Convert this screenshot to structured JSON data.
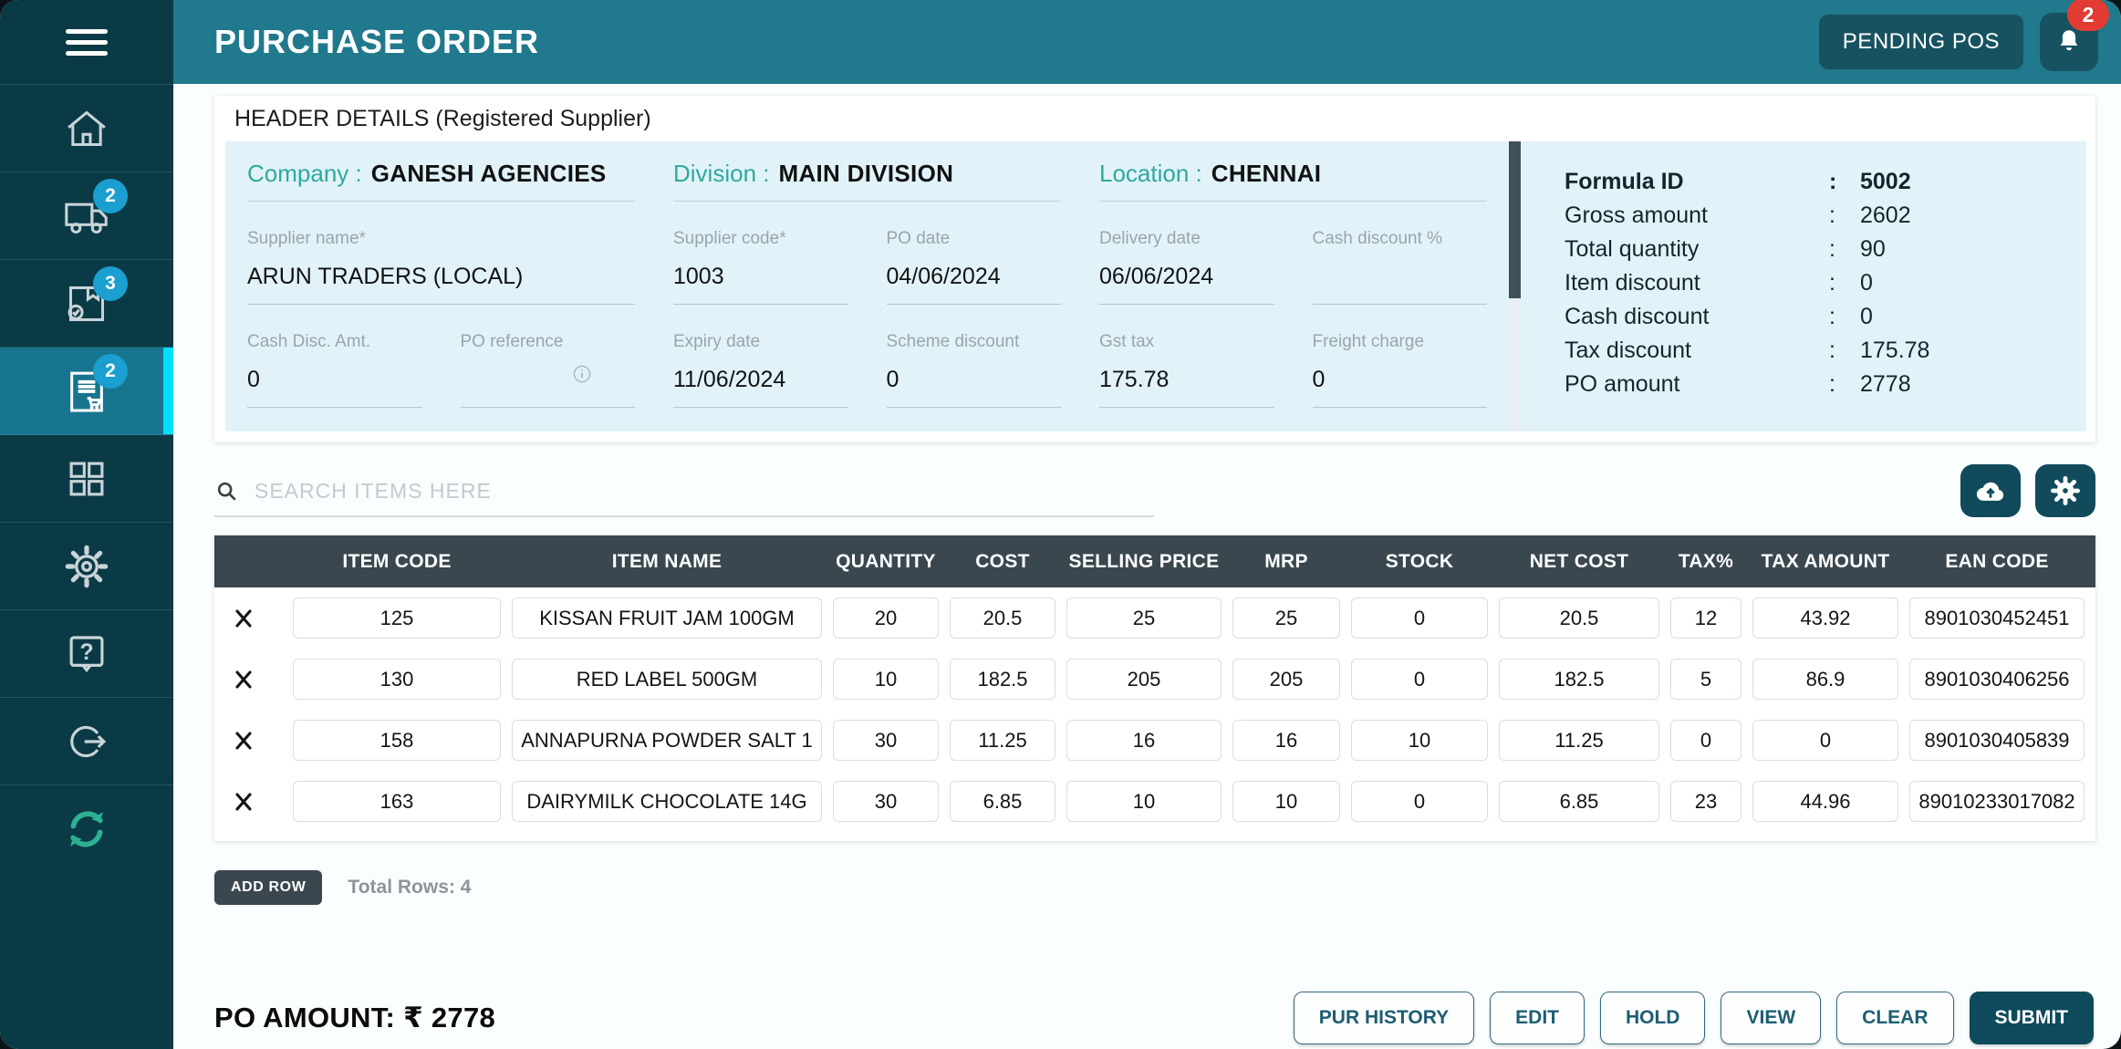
{
  "topbar": {
    "title": "PURCHASE ORDER",
    "pending_pos": "PENDING POS",
    "notification_count": "2"
  },
  "sidebar": {
    "truck_badge": "2",
    "grn_badge": "3",
    "purchase_badge": "2"
  },
  "header": {
    "title": "HEADER DETAILS (Registered Supplier)",
    "company_label": "Company :",
    "company_value": "GANESH AGENCIES",
    "division_label": "Division :",
    "division_value": "MAIN DIVISION",
    "location_label": "Location :",
    "location_value": "CHENNAI",
    "fields": {
      "supplier_name": {
        "label": "Supplier name*",
        "value": "ARUN TRADERS (LOCAL)"
      },
      "supplier_code": {
        "label": "Supplier code*",
        "value": "1003"
      },
      "po_date": {
        "label": "PO date",
        "value": "04/06/2024"
      },
      "delivery_date": {
        "label": "Delivery date",
        "value": "06/06/2024"
      },
      "cash_discount_pct": {
        "label": "Cash discount %",
        "value": ""
      },
      "cash_disc_amt": {
        "label": "Cash Disc. Amt.",
        "value": "0"
      },
      "po_reference": {
        "label": "PO reference",
        "value": ""
      },
      "expiry_date": {
        "label": "Expiry date",
        "value": "11/06/2024"
      },
      "scheme_discount": {
        "label": "Scheme discount",
        "value": "0"
      },
      "gst_tax": {
        "label": "Gst tax",
        "value": "175.78"
      },
      "freight_charge": {
        "label": "Freight charge",
        "value": "0"
      }
    }
  },
  "summary": {
    "rows": [
      {
        "label": "Formula ID",
        "value": "5002"
      },
      {
        "label": "Gross amount",
        "value": "2602"
      },
      {
        "label": "Total quantity",
        "value": "90"
      },
      {
        "label": "Item discount",
        "value": "0"
      },
      {
        "label": "Cash discount",
        "value": "0"
      },
      {
        "label": "Tax discount",
        "value": "175.78"
      },
      {
        "label": "PO amount",
        "value": "2778"
      }
    ]
  },
  "search": {
    "placeholder": "SEARCH ITEMS HERE"
  },
  "table": {
    "columns": [
      "ITEM CODE",
      "ITEM NAME",
      "QUANTITY",
      "COST",
      "SELLING PRICE",
      "MRP",
      "STOCK",
      "NET COST",
      "TAX%",
      "TAX AMOUNT",
      "EAN CODE"
    ],
    "rows": [
      {
        "item_code": "125",
        "item_name": "KISSAN FRUIT JAM 100GM",
        "quantity": "20",
        "cost": "20.5",
        "selling_price": "25",
        "mrp": "25",
        "stock": "0",
        "net_cost": "20.5",
        "tax_pct": "12",
        "tax_amount": "43.92",
        "ean": "8901030452451"
      },
      {
        "item_code": "130",
        "item_name": "RED LABEL 500GM",
        "quantity": "10",
        "cost": "182.5",
        "selling_price": "205",
        "mrp": "205",
        "stock": "0",
        "net_cost": "182.5",
        "tax_pct": "5",
        "tax_amount": "86.9",
        "ean": "8901030406256"
      },
      {
        "item_code": "158",
        "item_name": "ANNAPURNA POWDER SALT 1",
        "quantity": "30",
        "cost": "11.25",
        "selling_price": "16",
        "mrp": "16",
        "stock": "10",
        "net_cost": "11.25",
        "tax_pct": "0",
        "tax_amount": "0",
        "ean": "8901030405839"
      },
      {
        "item_code": "163",
        "item_name": "DAIRYMILK CHOCOLATE 14G",
        "quantity": "30",
        "cost": "6.85",
        "selling_price": "10",
        "mrp": "10",
        "stock": "0",
        "net_cost": "6.85",
        "tax_pct": "23",
        "tax_amount": "44.96",
        "ean": "89010233017082"
      }
    ],
    "add_row_label": "ADD ROW",
    "total_rows": "Total Rows: 4"
  },
  "footer": {
    "po_amount": "PO AMOUNT: ₹ 2778",
    "buttons": [
      "PUR HISTORY",
      "EDIT",
      "HOLD",
      "VIEW",
      "CLEAR",
      "SUBMIT"
    ]
  },
  "colors": {
    "topbar_teal": "#20798C",
    "sidebar_dark": "#0B3A47",
    "active_item": "#17758F",
    "accent_cyan": "#00E0FF",
    "badge_cyan": "#1B9FD0",
    "notification_red": "#E23B33",
    "panel_blue": "#E1F3F9",
    "label_teal": "#2FA99E",
    "table_header": "#3A474F",
    "button_dark": "#0E4A5C",
    "sync_green": "#2DB092"
  }
}
